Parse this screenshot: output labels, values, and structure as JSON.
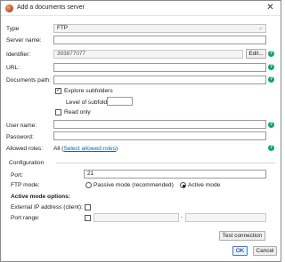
{
  "window": {
    "title": "Add a documents server",
    "close_glyph": "✕",
    "app_icon": "app-logo-icon"
  },
  "form": {
    "type_label": "Type",
    "type_value": "FTP",
    "server_name_label": "Server name:",
    "server_name_value": "",
    "identifier_label": "Identifier:",
    "identifier_value": "393877077",
    "edit_button": "Edit...",
    "url_label": "URL:",
    "url_value": "",
    "documents_path_label": "Documents path:",
    "documents_path_value": "",
    "explore_subfolders_label": "Explore subfolders",
    "explore_subfolders_checked": true,
    "level_subfolders_label": "Level of subfolders:",
    "level_subfolders_value": "",
    "read_only_label": "Read only",
    "read_only_checked": false,
    "user_name_label": "User name:",
    "user_name_value": "",
    "password_label": "Password:",
    "password_value": "",
    "allowed_roles_label": "Allowed roles:",
    "allowed_roles_value": "All",
    "select_roles_link": "Select allowed roles",
    "help_glyph": "?"
  },
  "configuration": {
    "section_label": "Configuration",
    "port_label": "Port:",
    "port_value": "21",
    "ftp_mode_label": "FTP mode:",
    "passive_mode_label": "Passive mode (recommended)",
    "active_mode_label": "Active mode",
    "selected_mode": "active",
    "active_options_label": "Active mode options:",
    "external_ip_label": "External IP address (client):",
    "port_range_label": "Port range:",
    "port_range_from": "",
    "port_range_to": "",
    "range_separator": "-"
  },
  "buttons": {
    "test_connection": "Test connection",
    "ok": "OK",
    "cancel": "Cancel"
  },
  "colors": {
    "help_badge": "#14a36e",
    "link": "#1a5fb4",
    "default_button_border": "#3b7fd6"
  }
}
